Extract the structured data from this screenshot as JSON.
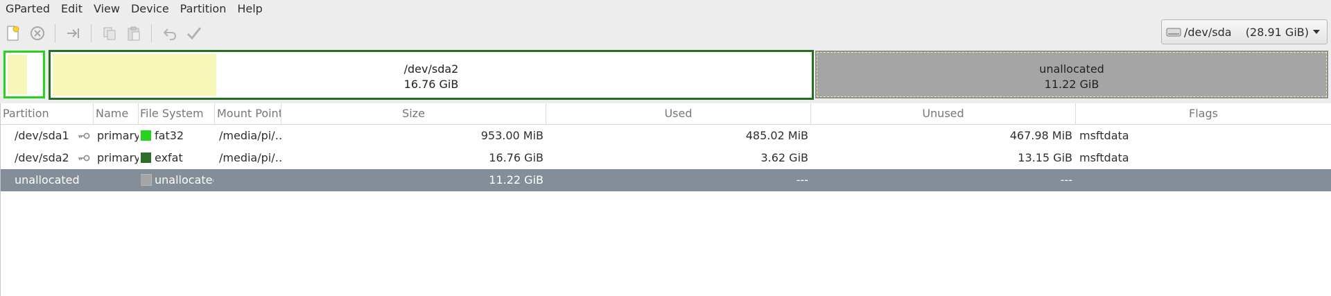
{
  "menubar": {
    "items": [
      {
        "label": "GParted"
      },
      {
        "label": "Edit"
      },
      {
        "label": "View"
      },
      {
        "label": "Device"
      },
      {
        "label": "Partition"
      },
      {
        "label": "Help"
      }
    ]
  },
  "toolbar": {
    "buttons": [
      {
        "icon": "new-icon",
        "enabled": true
      },
      {
        "icon": "delete-icon",
        "enabled": false
      },
      {
        "icon": "resize-move-icon",
        "enabled": false
      },
      {
        "icon": "copy-icon",
        "enabled": false
      },
      {
        "icon": "paste-icon",
        "enabled": false
      },
      {
        "icon": "undo-icon",
        "enabled": false
      },
      {
        "icon": "apply-icon",
        "enabled": false
      }
    ]
  },
  "device_selector": {
    "device": "/dev/sda",
    "size": "(28.91 GiB)"
  },
  "disk_map": {
    "segments": [
      {
        "name": "/dev/sda1",
        "size": ""
      },
      {
        "name": "/dev/sda2",
        "size": "16.76 GiB"
      },
      {
        "name": "unallocated",
        "size": "11.22 GiB"
      }
    ]
  },
  "table": {
    "headers": [
      "Partition",
      "Name",
      "File System",
      "Mount Point",
      "Size",
      "Used",
      "Unused",
      "Flags"
    ],
    "rows": [
      {
        "partition": "/dev/sda1",
        "type": "primary",
        "filesystem": "fat32",
        "fs_color": "#27d31e",
        "mount": "/media/pi/…",
        "size": "953.00 MiB",
        "used": "485.02 MiB",
        "unused": "467.98 MiB",
        "flags": "msftdata",
        "locked": true
      },
      {
        "partition": "/dev/sda2",
        "type": "primary",
        "filesystem": "exfat",
        "fs_color": "#2a6e2a",
        "mount": "/media/pi/…",
        "size": "16.76 GiB",
        "used": "3.62 GiB",
        "unused": "13.15 GiB",
        "flags": "msftdata",
        "locked": true
      },
      {
        "partition": "unallocated",
        "type": "",
        "filesystem": "unallocated",
        "fs_color": "#a5a5a5",
        "mount": "",
        "size": "11.22 GiB",
        "used": "---",
        "unused": "---",
        "flags": "",
        "locked": false,
        "selected": true
      }
    ]
  },
  "colors": {
    "selection": "#838e99",
    "used_space": "#f6f6b8",
    "unallocated": "#a5a5a5"
  }
}
